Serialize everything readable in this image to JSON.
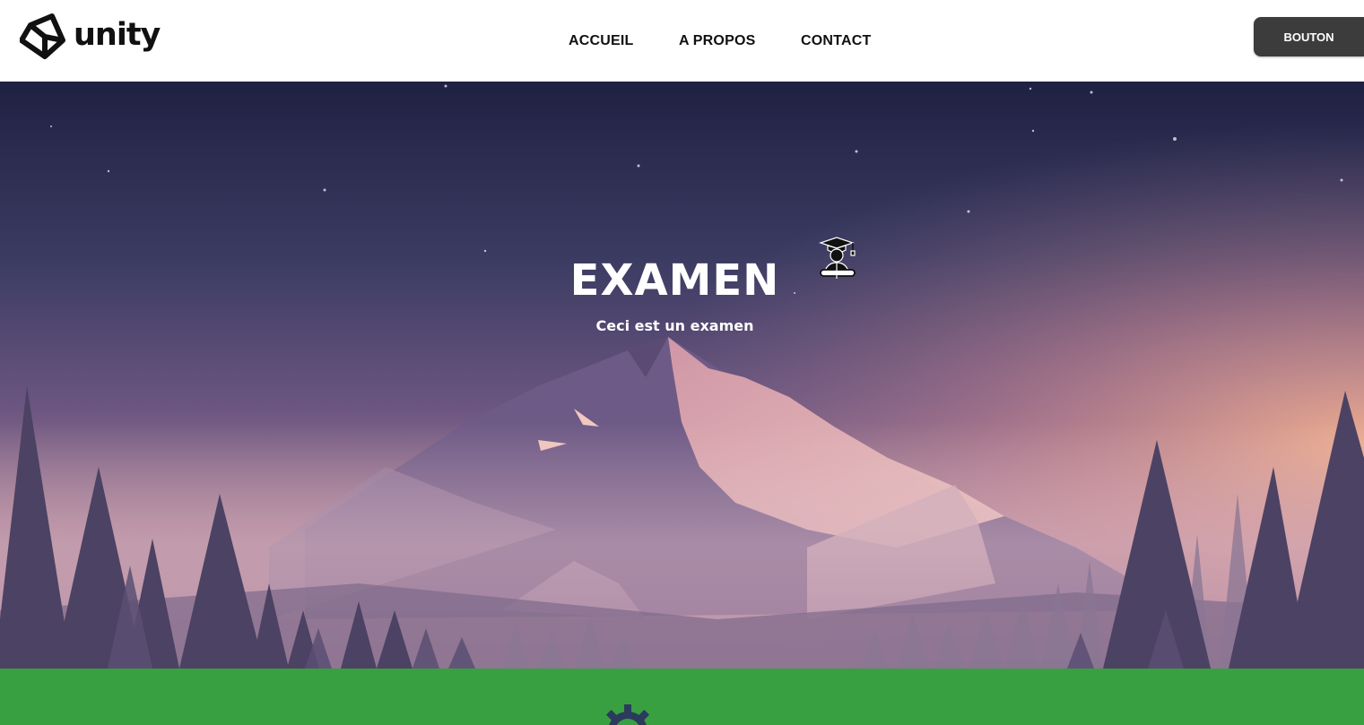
{
  "header": {
    "logo": {
      "text": "unity",
      "icon": "unity-cube-icon"
    },
    "nav": [
      {
        "label": "ACCUEIL"
      },
      {
        "label": "A PROPOS"
      },
      {
        "label": "CONTACT"
      }
    ],
    "button_label": "BOUTON"
  },
  "hero": {
    "title": "EXAMEN",
    "subtitle": "Ceci est un examen",
    "icons": [
      "moon-icon",
      "graduate-icon"
    ],
    "colors": {
      "sky_top": "#1f2142",
      "sky_bottom": "#e6a89a",
      "glow": "#f2b18f"
    }
  },
  "section": {
    "background": "#38a040",
    "icon": "gear-icon"
  }
}
